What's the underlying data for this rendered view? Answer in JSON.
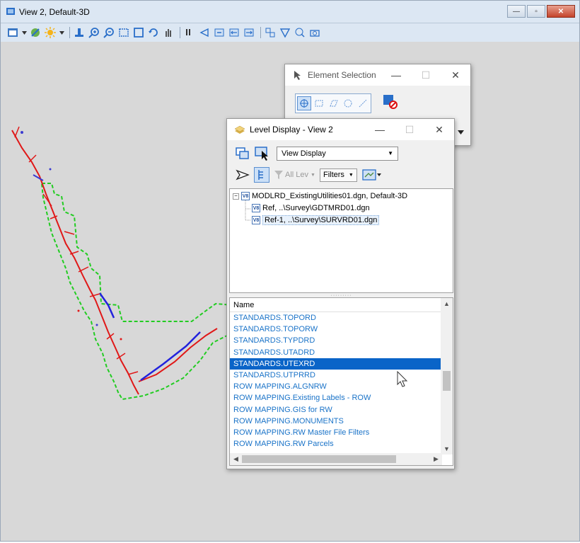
{
  "view_window": {
    "title": "View 2, Default-3D",
    "buttons": {
      "minimize": "—",
      "restore": "▫",
      "close": "✕"
    }
  },
  "toolbar": {
    "icons": [
      "view-attributes-icon",
      "brightness-icon",
      "render-icon",
      "level-display-icon",
      "zoom-in-icon",
      "zoom-out-icon",
      "window-area-icon",
      "fit-view-icon",
      "rotate-view-icon",
      "pan-view-icon",
      "walk-icon",
      "view-previous-icon",
      "view-next-icon",
      "copy-view-icon",
      "clip-volume-icon",
      "clip-mask-icon",
      "camera-icon"
    ]
  },
  "element_selection": {
    "title": "Element Selection",
    "caption_min": "—",
    "caption_max": "☐",
    "caption_close": "✕"
  },
  "level_display": {
    "title": "Level Display - View 2",
    "caption_min": "—",
    "caption_max": "☐",
    "caption_close": "✕",
    "display_mode": "View Display",
    "all_levels": "All Lev",
    "filters_label": "Filters",
    "tree": {
      "root": "MODLRD_ExistingUtilities01.dgn, Default-3D",
      "children": [
        "Ref, ..\\Survey\\GDTMRD01.dgn",
        "Ref-1, ..\\Survey\\SURVRD01.dgn"
      ]
    },
    "list_header": "Name",
    "levels": [
      "STANDARDS.TOPORD",
      "STANDARDS.TOPORW",
      "STANDARDS.TYPDRD",
      "STANDARDS.UTADRD",
      "STANDARDS.UTEXRD",
      "STANDARDS.UTPRRD",
      "ROW MAPPING.ALGNRW",
      "ROW MAPPING.Existing Labels - ROW",
      "ROW MAPPING.GIS for RW",
      "ROW MAPPING.MONUMENTS",
      "ROW MAPPING.RW Master File Filters",
      "ROW MAPPING.RW Parcels"
    ],
    "selected_level": "STANDARDS.UTEXRD"
  },
  "colors": {
    "titlebar": "#dce7f3",
    "canvas": "#d8d8d8",
    "level_link": "#1a73c8",
    "selection": "#0a64c8",
    "boundary_green": "#22cc22",
    "linework_red": "#e01818",
    "linework_blue": "#2222dd"
  }
}
